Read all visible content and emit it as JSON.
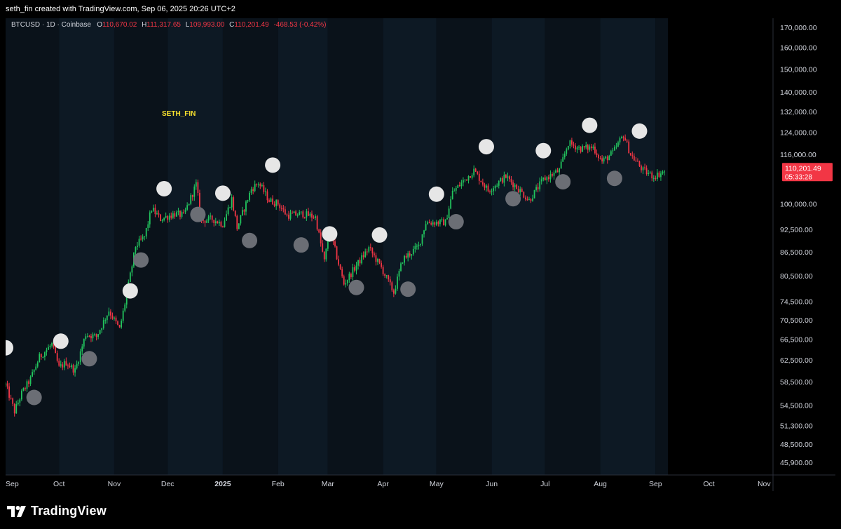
{
  "header": {
    "caption": "seth_fin created with TradingView.com, Sep 06, 2025 20:26 UTC+2"
  },
  "legend": {
    "symbol": "BTCUSD · 1D · Coinbase",
    "open_label": "O",
    "open_value": "110,670.02",
    "high_label": "H",
    "high_value": "111,317.65",
    "low_label": "L",
    "low_value": "109,993.00",
    "close_label": "C",
    "close_value": "110,201.49",
    "change_value": "-468.53 (-0.42%)"
  },
  "watermark_text": "SETH_FIN",
  "price_tag": {
    "price": "110,201.49",
    "countdown": "05:33:28",
    "color": "#f23645"
  },
  "footer": {
    "brand": "TradingView"
  },
  "colors": {
    "up": "#22c55e",
    "down": "#f23645",
    "marker_high": "#e6e6e6",
    "marker_low": "#6b6e75",
    "panel_dark": "#0a121a",
    "panel_light": "#0d1924"
  },
  "chart_data": {
    "type": "candlestick",
    "scale": "log",
    "symbol": "BTCUSD",
    "interval": "1D",
    "exchange": "Coinbase",
    "y_ticks": [
      "170,000.00",
      "160,000.00",
      "150,000.00",
      "140,000.00",
      "132,000.00",
      "124,000.00",
      "116,000.00",
      "100,000.00",
      "92,500.00",
      "86,500.00",
      "80,500.00",
      "74,500.00",
      "70,500.00",
      "66,500.00",
      "62,500.00",
      "58,500.00",
      "54,500.00",
      "51,300.00",
      "48,500.00",
      "45,900.00"
    ],
    "y_tick_values": [
      170000,
      160000,
      150000,
      140000,
      132000,
      124000,
      116000,
      100000,
      92500,
      86500,
      80500,
      74500,
      70500,
      66500,
      62500,
      58500,
      54500,
      51300,
      48500,
      45900
    ],
    "x_ticks": [
      "Sep",
      "Oct",
      "Nov",
      "Dec",
      "2025",
      "Feb",
      "Mar",
      "Apr",
      "May",
      "Jun",
      "Jul",
      "Aug",
      "Sep",
      "Oct",
      "Nov"
    ],
    "x_tick_dates": [
      "2024-09-01",
      "2024-10-01",
      "2024-11-01",
      "2024-12-01",
      "2025-01-01",
      "2025-02-01",
      "2025-03-01",
      "2025-04-01",
      "2025-05-01",
      "2025-06-01",
      "2025-07-01",
      "2025-08-01",
      "2025-09-01",
      "2025-10-01",
      "2025-11-01"
    ],
    "x_range": [
      "2024-09-01",
      "2025-11-06"
    ],
    "last_date": "2025-09-06",
    "price_path": [
      [
        "2024-09-01",
        58000
      ],
      [
        "2024-09-06",
        53500
      ],
      [
        "2024-09-10",
        56500
      ],
      [
        "2024-09-15",
        59000
      ],
      [
        "2024-09-20",
        63000
      ],
      [
        "2024-09-27",
        65500
      ],
      [
        "2024-10-01",
        61000
      ],
      [
        "2024-10-05",
        62000
      ],
      [
        "2024-10-10",
        60500
      ],
      [
        "2024-10-16",
        67500
      ],
      [
        "2024-10-22",
        67000
      ],
      [
        "2024-10-29",
        72500
      ],
      [
        "2024-11-04",
        68500
      ],
      [
        "2024-11-08",
        76000
      ],
      [
        "2024-11-13",
        88000
      ],
      [
        "2024-11-18",
        90500
      ],
      [
        "2024-11-22",
        98500
      ],
      [
        "2024-11-27",
        95500
      ],
      [
        "2024-12-05",
        97000
      ],
      [
        "2024-12-10",
        96500
      ],
      [
        "2024-12-17",
        106000
      ],
      [
        "2024-12-20",
        95000
      ],
      [
        "2024-12-26",
        95500
      ],
      [
        "2025-01-01",
        94000
      ],
      [
        "2025-01-06",
        101500
      ],
      [
        "2025-01-09",
        93000
      ],
      [
        "2025-01-17",
        104500
      ],
      [
        "2025-01-21",
        106500
      ],
      [
        "2025-01-27",
        101000
      ],
      [
        "2025-02-01",
        100000
      ],
      [
        "2025-02-06",
        96500
      ],
      [
        "2025-02-15",
        97000
      ],
      [
        "2025-02-22",
        96000
      ],
      [
        "2025-02-27",
        84000
      ],
      [
        "2025-03-02",
        92500
      ],
      [
        "2025-03-10",
        78500
      ],
      [
        "2025-03-17",
        83000
      ],
      [
        "2025-03-24",
        87500
      ],
      [
        "2025-03-31",
        82500
      ],
      [
        "2025-04-07",
        76500
      ],
      [
        "2025-04-12",
        84500
      ],
      [
        "2025-04-21",
        88000
      ],
      [
        "2025-04-25",
        94500
      ],
      [
        "2025-05-06",
        94500
      ],
      [
        "2025-05-10",
        103500
      ],
      [
        "2025-05-22",
        110500
      ],
      [
        "2025-05-30",
        104000
      ],
      [
        "2025-06-09",
        108500
      ],
      [
        "2025-06-16",
        104500
      ],
      [
        "2025-06-22",
        101000
      ],
      [
        "2025-06-30",
        107500
      ],
      [
        "2025-07-09",
        110500
      ],
      [
        "2025-07-14",
        120000
      ],
      [
        "2025-07-21",
        118000
      ],
      [
        "2025-07-28",
        118500
      ],
      [
        "2025-08-02",
        113500
      ],
      [
        "2025-08-08",
        116500
      ],
      [
        "2025-08-14",
        123000
      ],
      [
        "2025-08-18",
        116000
      ],
      [
        "2025-08-25",
        110500
      ],
      [
        "2025-08-31",
        108500
      ],
      [
        "2025-09-06",
        110200
      ]
    ],
    "swing_highs": [
      [
        "2024-09-01",
        64800
      ],
      [
        "2024-10-02",
        66100
      ],
      [
        "2024-11-10",
        76900
      ],
      [
        "2024-11-29",
        104600
      ],
      [
        "2025-01-01",
        103200
      ],
      [
        "2025-01-29",
        112300
      ],
      [
        "2025-03-02",
        91300
      ],
      [
        "2025-03-30",
        91000
      ],
      [
        "2025-05-01",
        102900
      ],
      [
        "2025-05-29",
        118700
      ],
      [
        "2025-06-30",
        117300
      ],
      [
        "2025-07-26",
        126600
      ],
      [
        "2025-08-23",
        124400
      ]
    ],
    "swing_lows": [
      [
        "2024-09-17",
        55800
      ],
      [
        "2024-10-18",
        62700
      ],
      [
        "2024-11-16",
        84400
      ],
      [
        "2024-12-18",
        96800
      ],
      [
        "2025-01-16",
        89500
      ],
      [
        "2025-02-14",
        88300
      ],
      [
        "2025-03-17",
        77700
      ],
      [
        "2025-04-15",
        77300
      ],
      [
        "2025-05-12",
        94700
      ],
      [
        "2025-06-13",
        101500
      ],
      [
        "2025-07-11",
        106800
      ],
      [
        "2025-08-09",
        107900
      ]
    ]
  }
}
